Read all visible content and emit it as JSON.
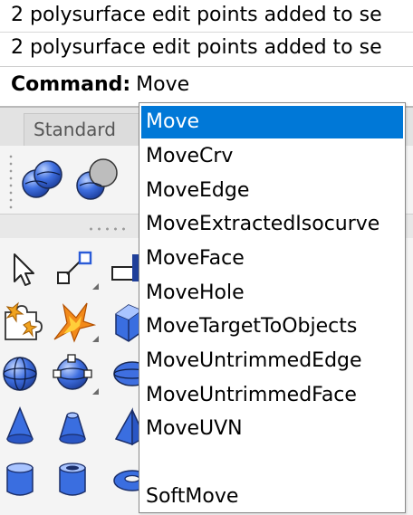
{
  "history": {
    "lines": [
      "2 polysurface edit points added to se",
      "2 polysurface edit points added to se"
    ]
  },
  "command": {
    "label": "Command:",
    "value": "Move"
  },
  "toolbar": {
    "tab_label": "Standard"
  },
  "autocomplete": {
    "selected_index": 0,
    "items": [
      "Move",
      "MoveCrv",
      "MoveEdge",
      "MoveExtractedIsocurve",
      "MoveFace",
      "MoveHole",
      "MoveTargetToObjects",
      "MoveUntrimmedEdge",
      "MoveUntrimmedFace",
      "MoveUVN",
      "",
      "SoftMove"
    ]
  },
  "icons": {
    "standard_row": [
      "boolean-union-spheres-icon",
      "boolean-difference-spheres-icon"
    ],
    "palette": [
      "select-arrow-icon",
      "move-points-icon",
      "box-edit-icon",
      "puzzle-sparkle-icon",
      "explode-icon",
      "box-solid-icon",
      "sphere-icon",
      "sphere-points-icon",
      "ellipsoid-icon",
      "cone-icon",
      "truncated-cone-icon",
      "pyramid-icon",
      "cylinder-icon",
      "tube-icon",
      "torus-icon"
    ]
  },
  "colors": {
    "selection": "#0078d7",
    "solid_blue": "#2e5fd0",
    "panel_bg": "#f4f4f4"
  }
}
